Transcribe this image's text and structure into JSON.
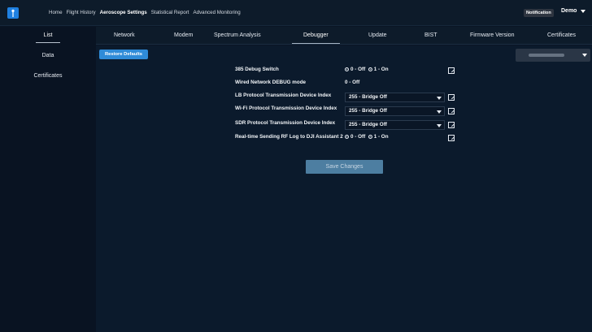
{
  "nav": {
    "items": [
      "Home",
      "Flight History",
      "Aeroscope Settings",
      "Statistical Report",
      "Advanced Monitoring"
    ],
    "active_index": 2,
    "notification_label": "Notification",
    "user_label": "Demo"
  },
  "sidebar": {
    "items": [
      "List",
      "Data",
      "Certificates"
    ],
    "active_index": 0
  },
  "tabs": {
    "items": [
      "Network",
      "Modem",
      "Spectrum Analysis",
      "Debugger",
      "Update",
      "BIST",
      "Firmware Version",
      "Certificates"
    ],
    "active_index": 3
  },
  "toolbar": {
    "restore_label": "Restore Defaults"
  },
  "debugger": {
    "rows": [
      {
        "label": "385 Debug Switch",
        "type": "radio",
        "options": [
          "0 - Off",
          "1 - On"
        ],
        "selected": 0,
        "editable": true
      },
      {
        "label": "Wired Network DEBUG mode",
        "type": "text",
        "value": "0 - Off",
        "editable": false
      },
      {
        "label": "LB Protocol Transmission Device Index",
        "type": "select",
        "value": "255 - Bridge Off",
        "editable": true
      },
      {
        "label": "Wi-Fi Protocol Transmission Device Index",
        "type": "select",
        "value": "255 - Bridge Off",
        "editable": true
      },
      {
        "label": "SDR Protocol Transmission Device Index",
        "type": "select",
        "value": "255 - Bridge Off",
        "editable": true
      },
      {
        "label": "Real-time Sending RF Log to DJI Assistant 2",
        "type": "radio",
        "options": [
          "0 - Off",
          "1 - On"
        ],
        "selected": 0,
        "editable": true
      }
    ],
    "save_label": "Save Changes"
  },
  "colors": {
    "accent": "#2f8bd8",
    "background": "#0b1a2c",
    "save_button": "#4d7ea1"
  }
}
